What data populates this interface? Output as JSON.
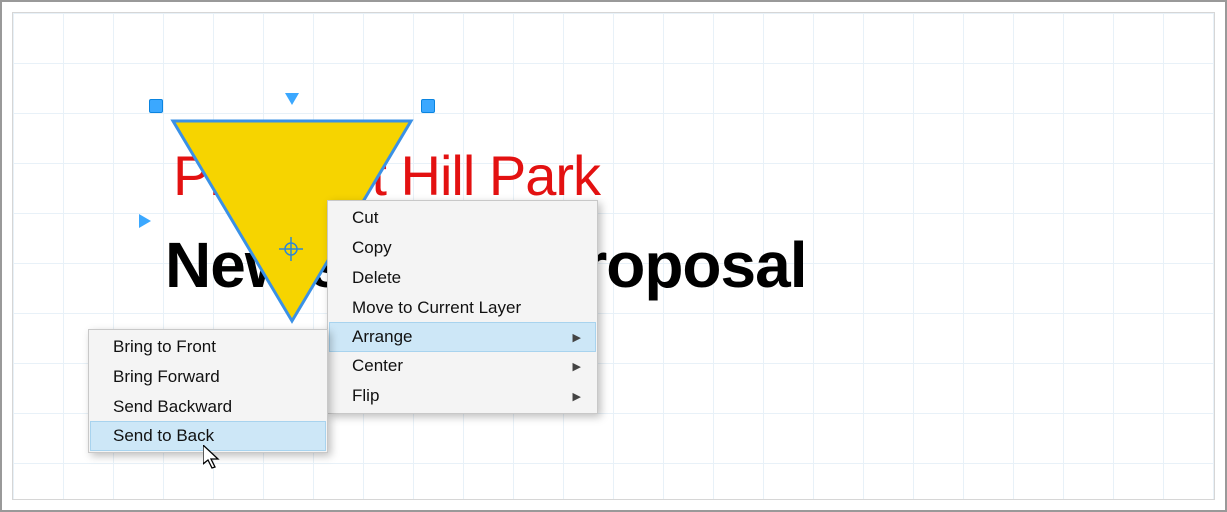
{
  "canvas": {
    "title_red": "Prospect Hill Park",
    "title_black": "New seating proposal",
    "shape_fill": "#f6d400",
    "shape_stroke": "#3a91e6",
    "selection_color": "#3ba8ff"
  },
  "context_menu": {
    "items": [
      {
        "label": "Cut",
        "submenu": false,
        "hover": false
      },
      {
        "label": "Copy",
        "submenu": false,
        "hover": false
      },
      {
        "label": "Delete",
        "submenu": false,
        "hover": false
      },
      {
        "label": "Move to Current Layer",
        "submenu": false,
        "hover": false
      },
      {
        "label": "Arrange",
        "submenu": true,
        "hover": true
      },
      {
        "label": "Center",
        "submenu": true,
        "hover": false
      },
      {
        "label": "Flip",
        "submenu": true,
        "hover": false
      }
    ]
  },
  "arrange_submenu": {
    "items": [
      {
        "label": "Bring to Front",
        "hover": false
      },
      {
        "label": "Bring Forward",
        "hover": false
      },
      {
        "label": "Send Backward",
        "hover": false
      },
      {
        "label": "Send to Back",
        "hover": true
      }
    ]
  }
}
